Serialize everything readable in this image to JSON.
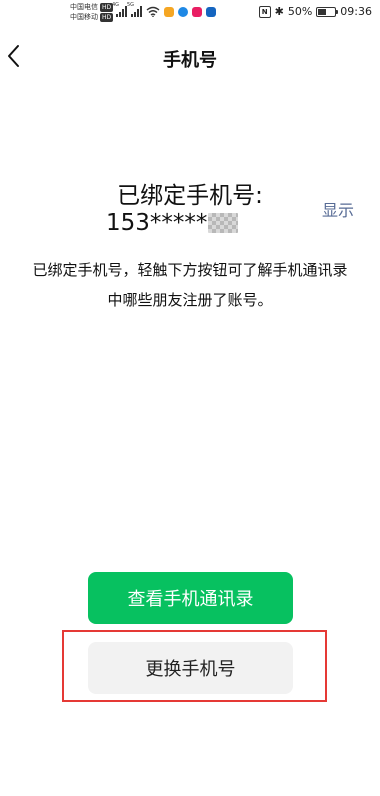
{
  "status_bar": {
    "carrier_1": "中国电信",
    "carrier_2": "中国移动",
    "hd_badge": "HD",
    "signal_1_tag": "4G",
    "signal_2_tag": "5G",
    "battery_percent_text": "50%",
    "battery_level": 0.5,
    "time": "09:36",
    "icons": [
      "wifi-icon",
      "app-notification-icons",
      "nfc-icon",
      "bluetooth-icon",
      "battery-icon"
    ],
    "colors": {
      "app_dot_1": "#f5a623",
      "app_dot_2": "#1e88e5",
      "app_dot_3": "#e91e63",
      "app_dot_4": "#1565c0"
    }
  },
  "nav": {
    "back_icon": "chevron-left-icon",
    "title": "手机号"
  },
  "main": {
    "bound_title": "已绑定手机号:",
    "phone_number_visible": "153*****",
    "show_link": "显示",
    "description": "已绑定手机号，轻触下方按钮可了解手机通讯录中哪些朋友注册了账号。"
  },
  "actions": {
    "view_contacts_label": "查看手机通讯录",
    "change_phone_label": "更换手机号"
  },
  "colors": {
    "primary_green": "#07c160",
    "link_blue": "#576b95",
    "secondary_bg": "#f2f2f2",
    "highlight_red": "#e53935"
  }
}
